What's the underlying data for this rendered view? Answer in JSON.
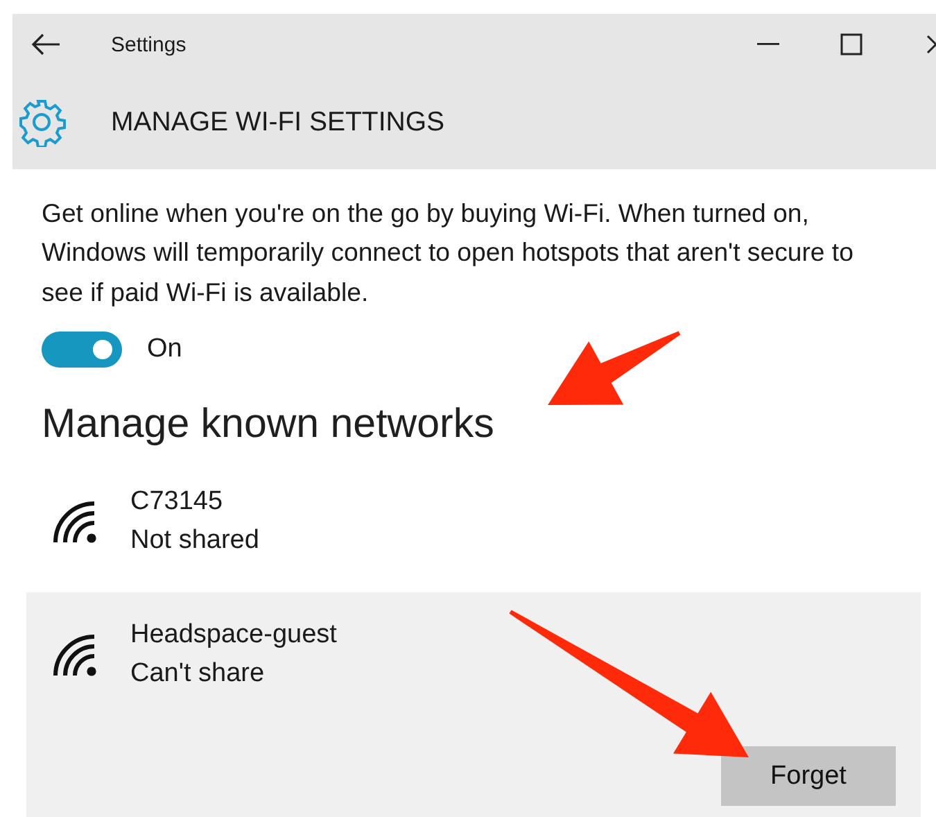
{
  "window": {
    "title": "Settings"
  },
  "header": {
    "title": "MANAGE WI-FI SETTINGS"
  },
  "description": "Get online when you're on the go by buying Wi-Fi. When turned on, Windows will temporarily connect to open hotspots that aren't secure to see if paid Wi-Fi is available.",
  "toggle": {
    "on": true,
    "label": "On"
  },
  "section_heading": "Manage known networks",
  "networks": [
    {
      "name": "C73145",
      "status": "Not shared",
      "selected": false
    },
    {
      "name": "Headspace-guest",
      "status": "Can't share",
      "selected": true,
      "button": "Forget"
    }
  ]
}
